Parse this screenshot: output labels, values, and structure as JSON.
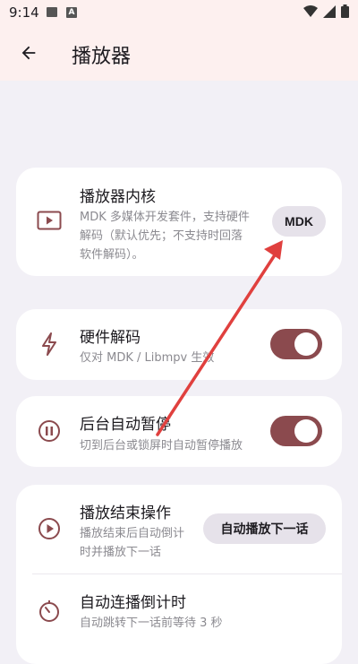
{
  "statusbar": {
    "time": "9:14",
    "a_badge": "A"
  },
  "appbar": {
    "title": "播放器"
  },
  "settings": {
    "core": {
      "title": "播放器内核",
      "sub1": "MDK 多媒体开发套件，支持硬件",
      "sub2": "解码（默认优先；不支持时回落",
      "sub3": "软件解码）。",
      "button": "MDK"
    },
    "hwdec": {
      "title": "硬件解码",
      "sub": "仅对 MDK / Libmpv 生效",
      "enabled": true
    },
    "bgpause": {
      "title": "后台自动暂停",
      "sub": "切到后台或锁屏时自动暂停播放",
      "enabled": true
    },
    "endaction": {
      "title": "播放结束操作",
      "sub1": "播放结束后自动倒计",
      "sub2": "时并播放下一话",
      "button": "自动播放下一话"
    },
    "countdown": {
      "title": "自动连播倒计时",
      "sub": "自动跳转下一话前等待 3 秒"
    }
  },
  "colors": {
    "accent": "#8b4a4e",
    "annotation_arrow": "#e0403e"
  }
}
